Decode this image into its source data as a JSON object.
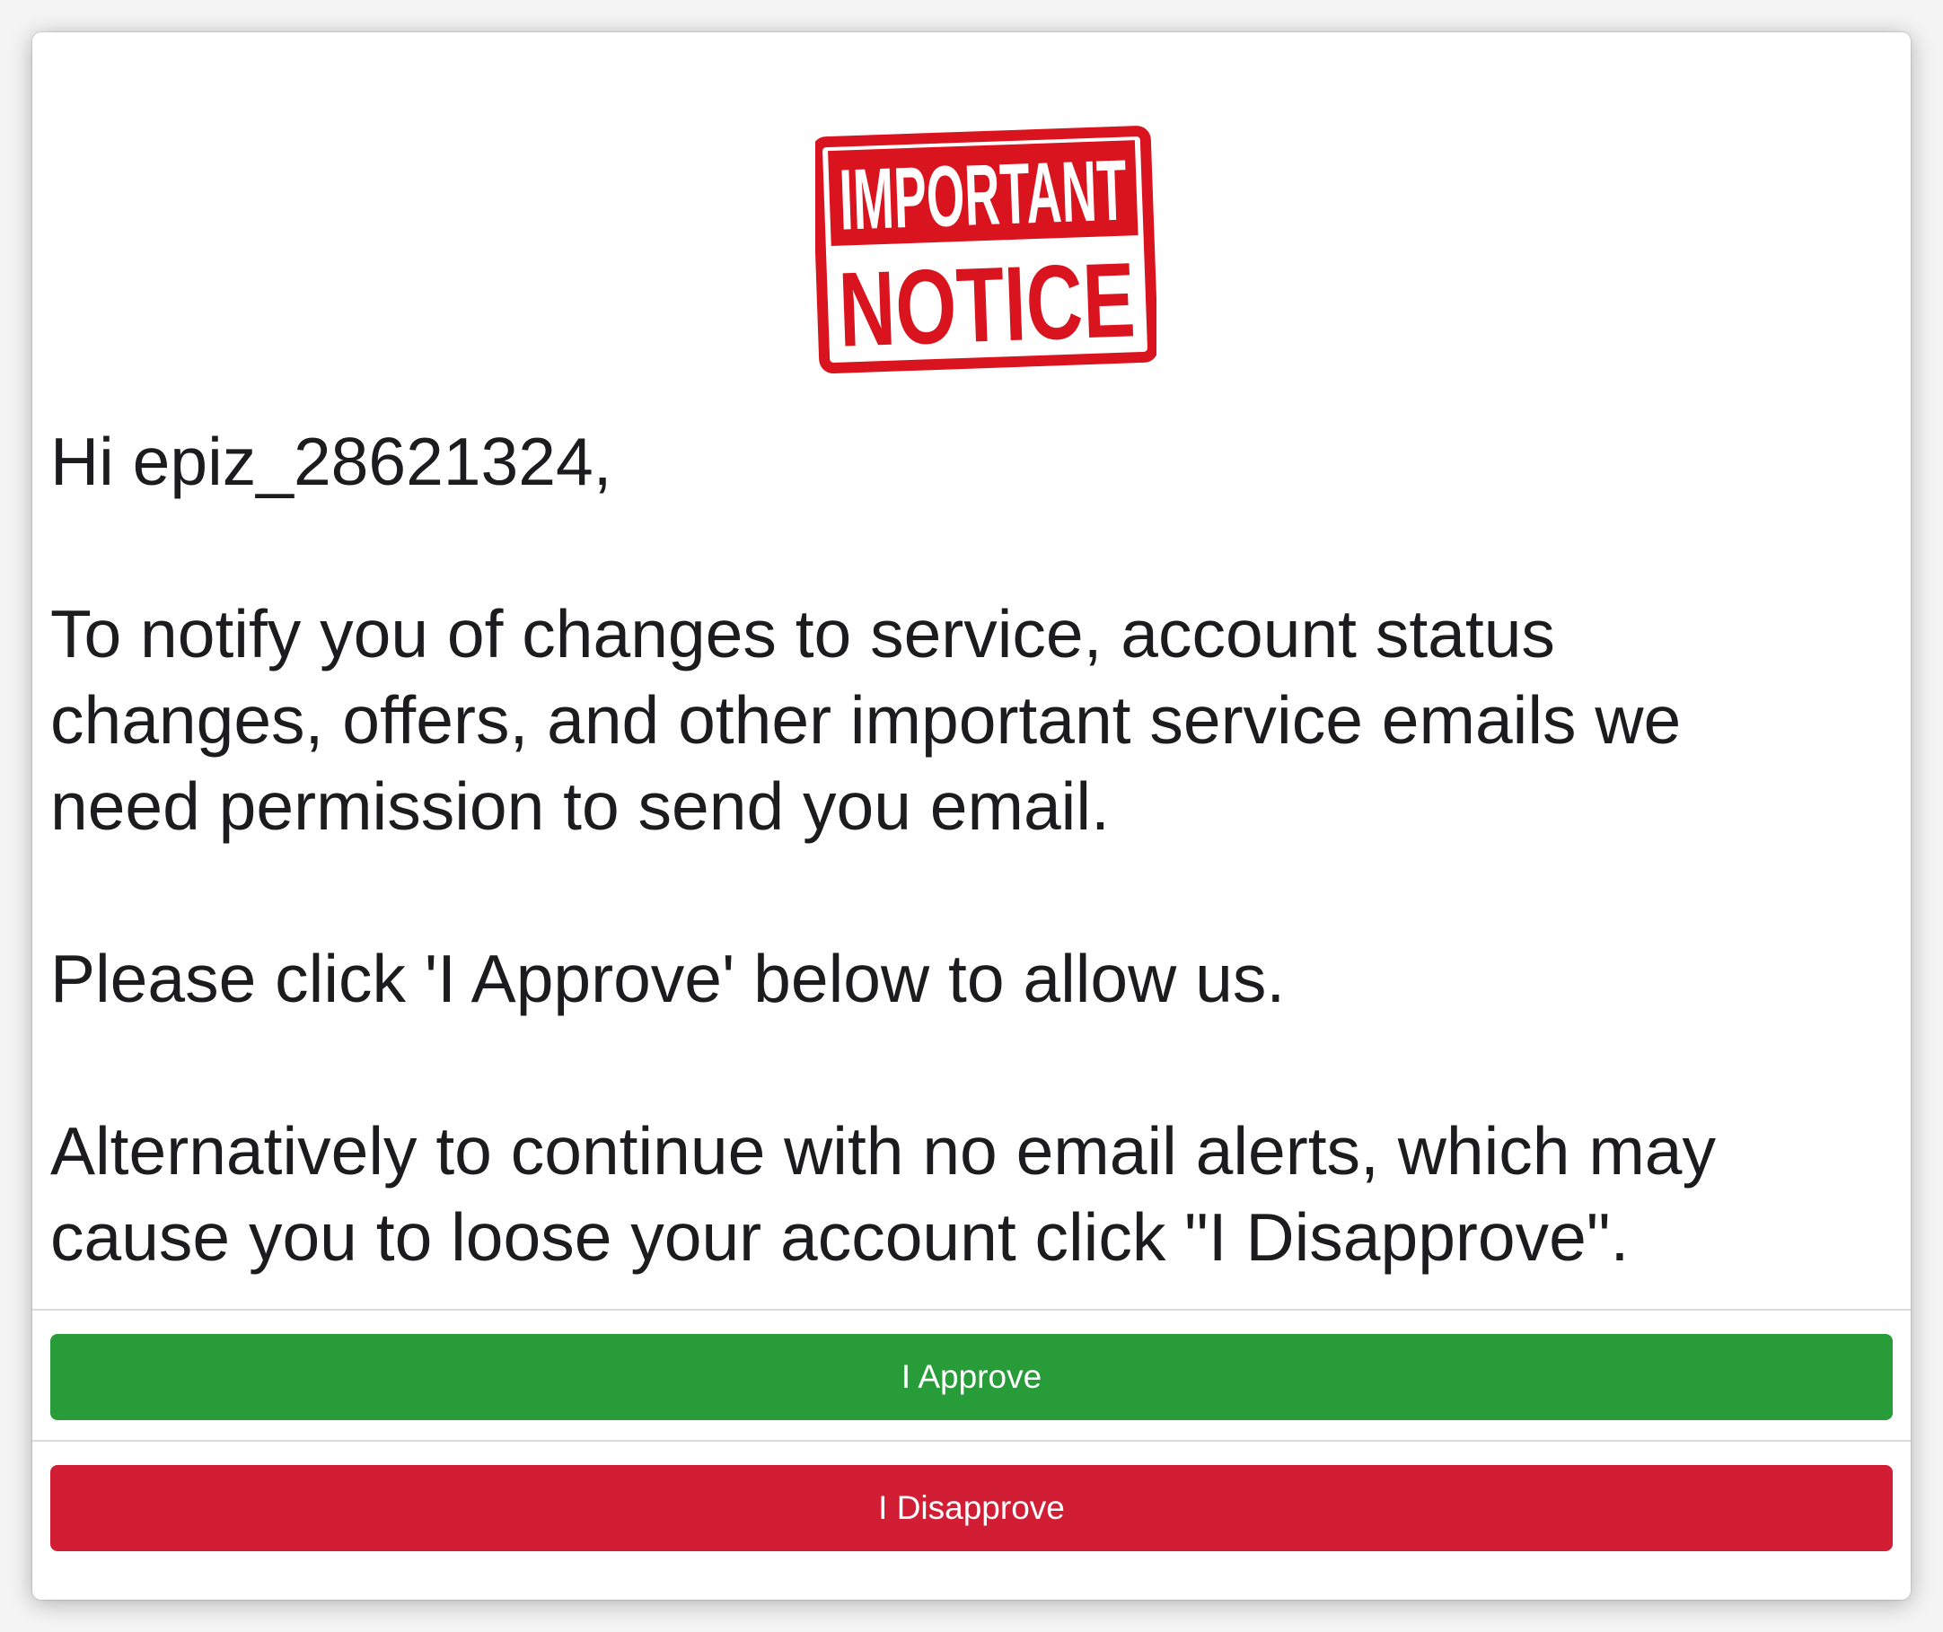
{
  "banner": {
    "line1": "IMPORTANT",
    "line2": "NOTICE",
    "color": "#d9141f"
  },
  "message": {
    "greeting": "Hi epiz_28621324,",
    "paragraph1_line1": "To notify you of changes to service, account status",
    "paragraph1_line2": "changes, offers, and other important service emails we",
    "paragraph1_line3": "need permission to send you email.",
    "paragraph2": "Please click 'I Approve' below to allow us.",
    "paragraph3_line1": "Alternatively to continue with no email alerts, which may",
    "paragraph3_line2": "cause you to loose your account click \"I Disapprove\"."
  },
  "actions": {
    "approve_label": "I Approve",
    "approve_color": "#279c38",
    "disapprove_label": "I Disapprove",
    "disapprove_color": "#d21e35"
  }
}
